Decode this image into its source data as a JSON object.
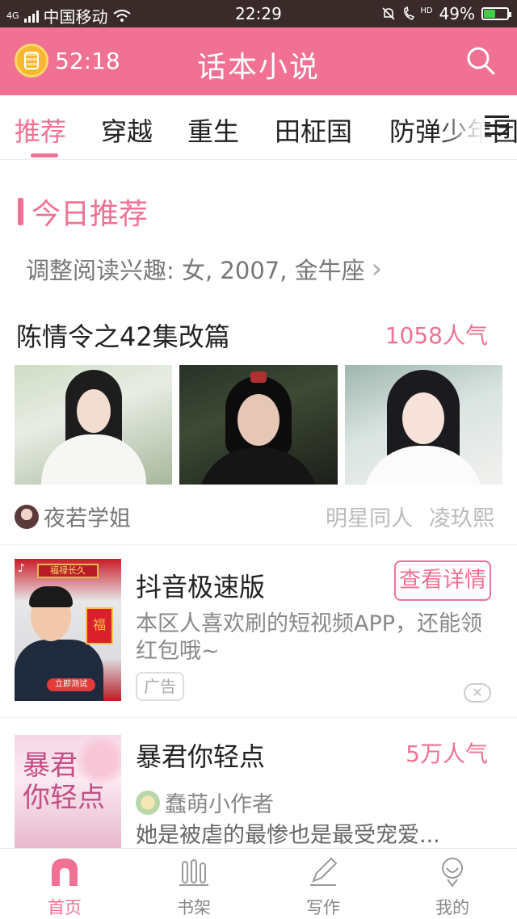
{
  "status_bar": {
    "network": "4G",
    "carrier": "中国移动",
    "time": "22:29",
    "hd": "HD",
    "battery": "49%",
    "battery_level": 0.49
  },
  "header": {
    "timer": "52:18",
    "title": "话本小说",
    "icons": [
      "alarm-clock-icon",
      "search-icon"
    ],
    "accent_color": "#f07193"
  },
  "tabs": [
    {
      "label": "推荐",
      "active": true
    },
    {
      "label": "穿越",
      "active": false
    },
    {
      "label": "重生",
      "active": false
    },
    {
      "label": "田柾国",
      "active": false
    },
    {
      "label": "防弹少年团",
      "active": false
    }
  ],
  "today": {
    "section_title": "今日推荐",
    "interest_text": "调整阅读兴趣: 女, 2007, 金牛座",
    "chevron": "›"
  },
  "book1": {
    "title": "陈情令之42集改篇",
    "popularity": "1058人气",
    "author": "夜若学姐",
    "tags": [
      "明星同人",
      "凌玖熙"
    ]
  },
  "ad": {
    "title": "抖音极速版",
    "button": "查看详情",
    "description": "本区人喜欢刷的短视频APP，还能领红包哦~",
    "label": "广告",
    "close": "✕",
    "thumb": {
      "banner": "福禄长久",
      "envelope": "福",
      "cta": "立即测试"
    }
  },
  "book2": {
    "title": "暴君你轻点",
    "popularity": "5万人气",
    "author": "蠢萌小作者",
    "description": "她是被虐的最惨也是最受宠爱...",
    "cover_text_1": "暴君",
    "cover_text_2": "你轻点"
  },
  "bottom_nav": [
    {
      "label": "首页",
      "icon": "home-icon",
      "active": true
    },
    {
      "label": "书架",
      "icon": "bookshelf-icon",
      "active": false
    },
    {
      "label": "写作",
      "icon": "pen-icon",
      "active": false
    },
    {
      "label": "我的",
      "icon": "profile-icon",
      "active": false
    }
  ]
}
